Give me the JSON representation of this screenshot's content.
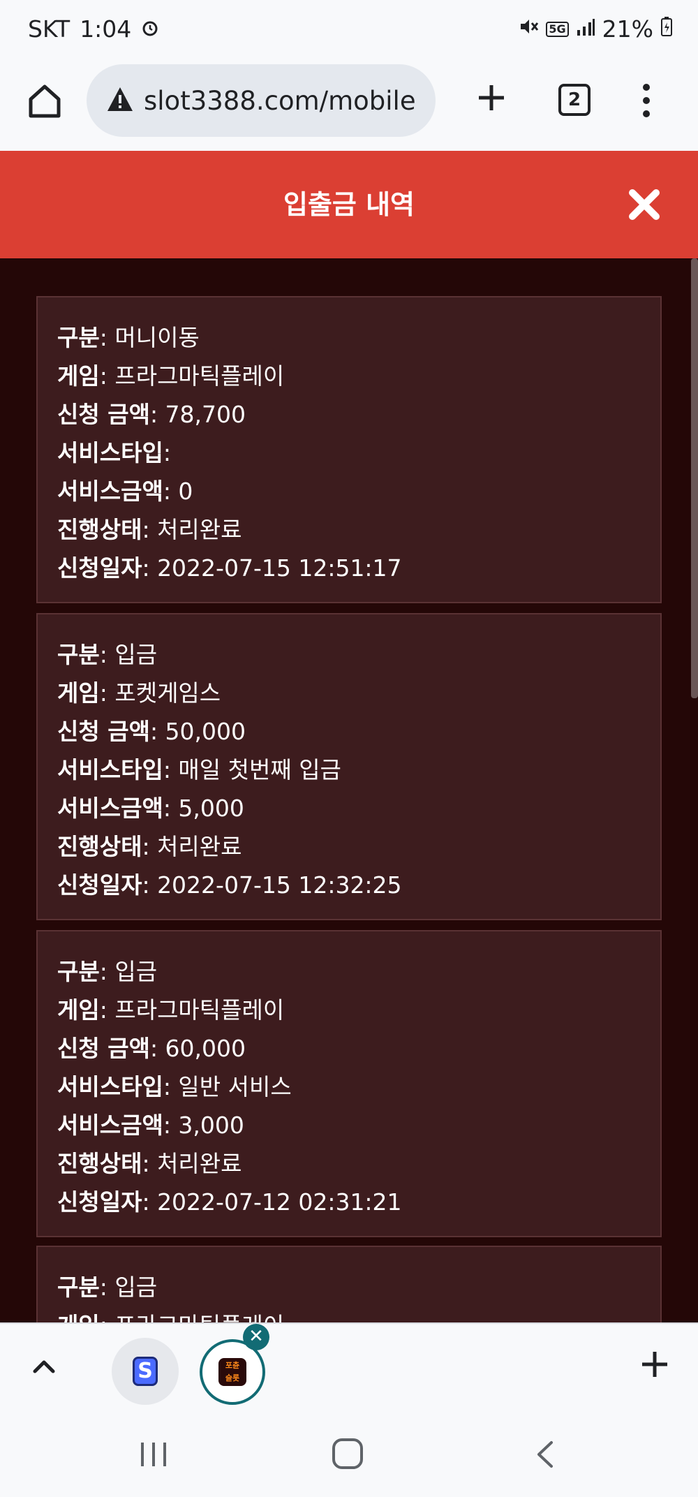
{
  "status_bar": {
    "carrier": "SKT",
    "time": "1:04",
    "network": "5G",
    "battery": "21%",
    "icons": [
      "alarm-icon",
      "mute-icon",
      "signal-icon",
      "battery-icon"
    ]
  },
  "browser": {
    "url": "slot3388.com/mobile",
    "tab_count": "2",
    "icons": [
      "home-icon",
      "warning-icon",
      "new-tab-icon",
      "tab-switcher-icon",
      "more-menu-icon"
    ]
  },
  "modal": {
    "title": "입출금 내역",
    "close_icon": "close-icon"
  },
  "labels": {
    "type": "구분",
    "game": "게임",
    "amount": "신청 금액",
    "service_type": "서비스타입",
    "service_amount": "서비스금액",
    "status": "진행상태",
    "date": "신청일자"
  },
  "records": [
    {
      "type": "머니이동",
      "game": "프라그마틱플레이",
      "amount": "78,700",
      "service_type": "",
      "service_amount": "0",
      "status": "처리완료",
      "date": "2022-07-15 12:51:17"
    },
    {
      "type": "입금",
      "game": "포켓게임스",
      "amount": "50,000",
      "service_type": "매일 첫번째 입금",
      "service_amount": "5,000",
      "status": "처리완료",
      "date": "2022-07-15 12:32:25"
    },
    {
      "type": "입금",
      "game": "프라그마틱플레이",
      "amount": "60,000",
      "service_type": "일반 서비스",
      "service_amount": "3,000",
      "status": "처리완료",
      "date": "2022-07-12 02:31:21"
    },
    {
      "type": "입금",
      "game": "프라그마틱플레이"
    }
  ],
  "tab_strip": {
    "tab1_letter": "S",
    "tab2_logo_line1": "포츈",
    "tab2_logo_line2": "슬롯",
    "close_badge": "✕",
    "plus": "+"
  },
  "colors": {
    "header_red": "#db3f33",
    "page_bg": "#240707",
    "card_bg": "#3d1c1e",
    "tab_accent": "#126b74"
  }
}
